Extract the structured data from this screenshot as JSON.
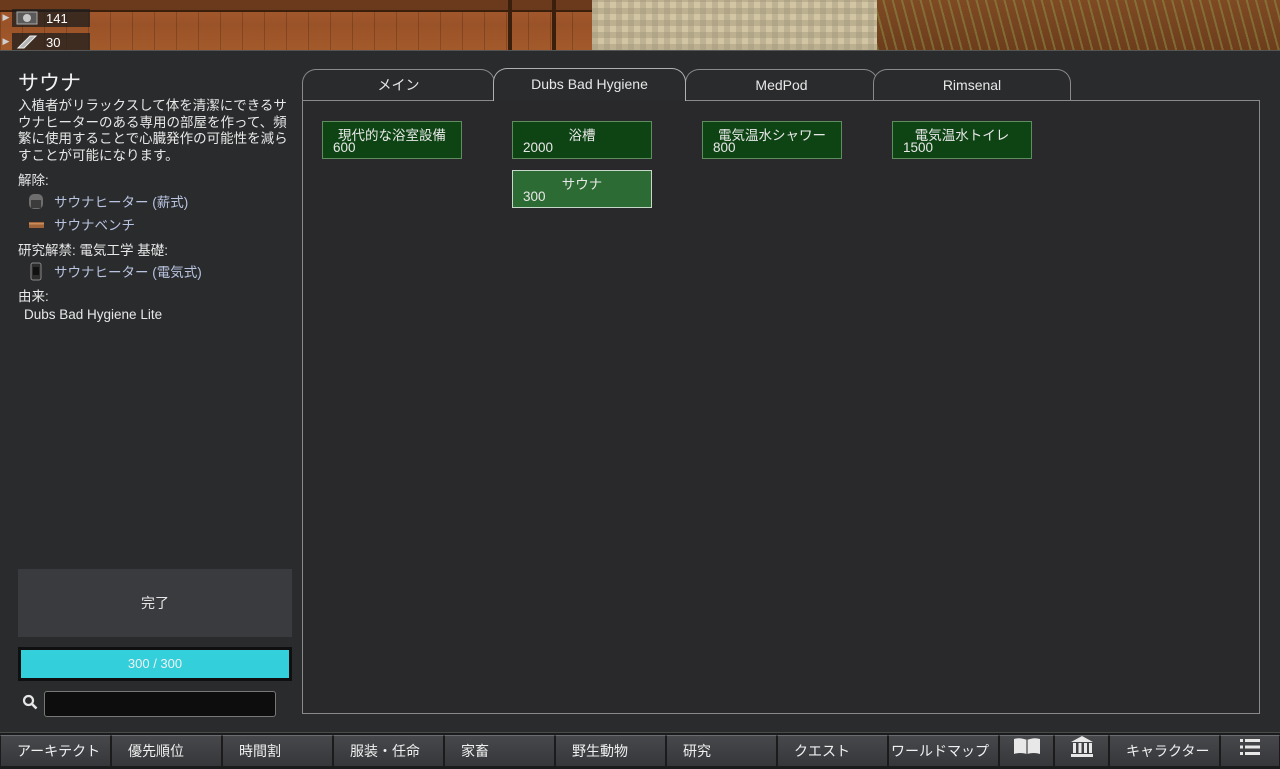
{
  "resources": [
    {
      "icon": "silver-icon",
      "count": "141"
    },
    {
      "icon": "steel-icon",
      "count": "30"
    }
  ],
  "project": {
    "title": "サウナ",
    "description": "入植者がリラックスして体を清潔にできるサウナヒーターのある専用の部屋を作って、頻繁に使用することで心臓発作の可能性を減らすことが可能になります。",
    "unlocks_label": "解除:",
    "unlocks": [
      {
        "label": "サウナヒーター (薪式)",
        "icon": "wood-heater-icon"
      },
      {
        "label": "サウナベンチ",
        "icon": "bench-icon"
      }
    ],
    "research_unlock_label": "研究解禁: 電気工学 基礎:",
    "research_unlocks": [
      {
        "label": "サウナヒーター (電気式)",
        "icon": "electric-heater-icon"
      }
    ],
    "source_label": "由来:",
    "source": "Dubs Bad Hygiene Lite",
    "complete_label": "完了",
    "progress_text": "300 / 300",
    "progress_fraction": 1.0
  },
  "search": {
    "value": "",
    "placeholder": ""
  },
  "tabs": [
    {
      "label": "メイン",
      "active": false
    },
    {
      "label": "Dubs Bad Hygiene",
      "active": true
    },
    {
      "label": "MedPod",
      "active": false
    },
    {
      "label": "Rimsenal",
      "active": false
    }
  ],
  "nodes": [
    {
      "title": "現代的な浴室設備",
      "cost": "600",
      "selected": false
    },
    {
      "title": "浴槽",
      "cost": "2000",
      "selected": false
    },
    {
      "title": "電気温水シャワー",
      "cost": "800",
      "selected": false
    },
    {
      "title": "電気温水トイレ",
      "cost": "1500",
      "selected": false
    },
    {
      "title": "サウナ",
      "cost": "300",
      "selected": true
    }
  ],
  "bottom_bar": [
    {
      "label": "アーキテクト"
    },
    {
      "label": "優先順位"
    },
    {
      "label": "時間割"
    },
    {
      "label": "服装・任命"
    },
    {
      "label": "家畜"
    },
    {
      "label": "野生動物"
    },
    {
      "label": "研究"
    },
    {
      "label": "クエスト"
    },
    {
      "label": "ワールドマップ"
    },
    {
      "label": "",
      "icon": "book-icon"
    },
    {
      "label": "",
      "icon": "factions-icon"
    },
    {
      "label": "キャラクター"
    },
    {
      "label": "",
      "icon": "menu-icon"
    }
  ],
  "colors": {
    "progress": "#33cfdb",
    "node": "#0e4414",
    "node_selected": "#2c6b33",
    "unlock_text": "#b9c4e0"
  }
}
